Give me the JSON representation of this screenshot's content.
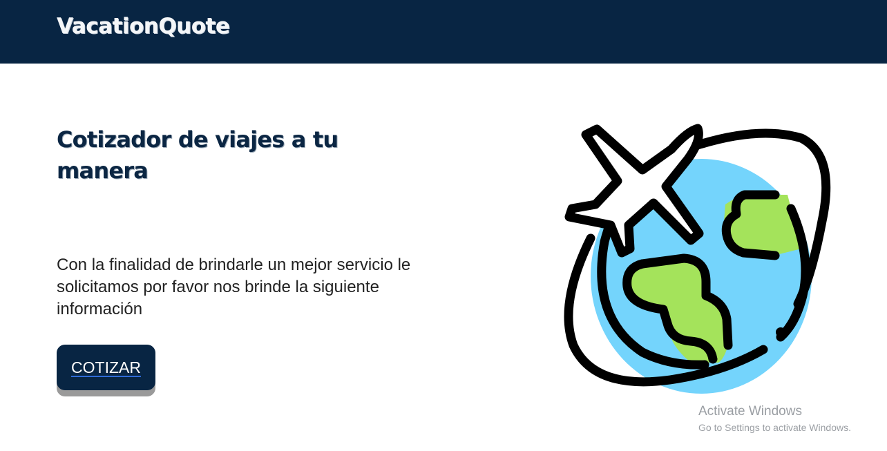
{
  "header": {
    "brand": "VacationQuote",
    "background_color": "#082543"
  },
  "hero": {
    "title": "Cotizador de viajes a tu manera",
    "description": "Con la finalidad de brindarle un mejor servicio le solicitamos por favor nos brinde la siguiente información",
    "cta_label": "COTIZAR"
  },
  "illustration": {
    "icon": "globe-airplane-icon",
    "ocean_color": "#74d4fc",
    "land_color": "#a4e35b",
    "outline_color": "#000000"
  },
  "watermark": {
    "title": "Activate Windows",
    "subtitle": "Go to Settings to activate Windows."
  }
}
